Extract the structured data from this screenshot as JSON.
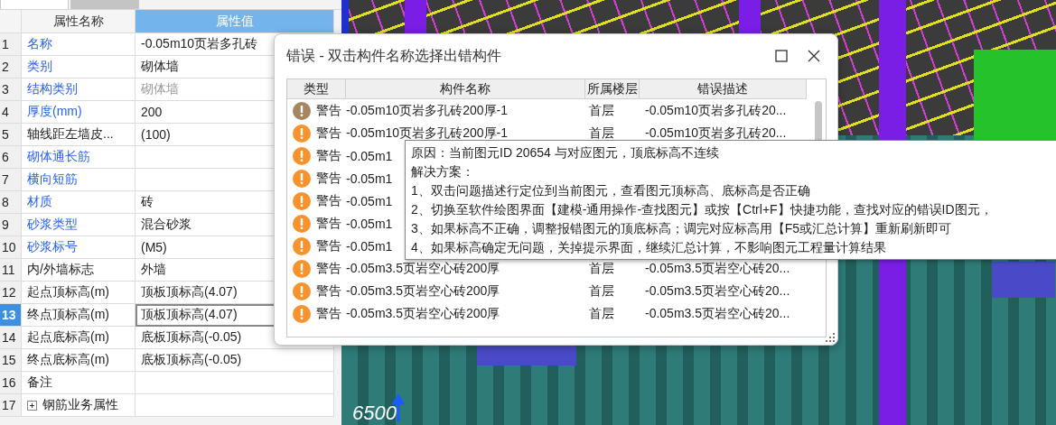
{
  "property_panel": {
    "tabs": [
      {
        "selected": true
      },
      {
        "selected": false
      }
    ],
    "columns": [
      {
        "label": "属性名称",
        "selected": false
      },
      {
        "label": "属性值",
        "selected": true
      }
    ],
    "rows": [
      {
        "number": "1",
        "name": "名称",
        "value": "-0.05m10页岩多孔砖",
        "highlighted": true,
        "disabled": false,
        "selected": false
      },
      {
        "number": "2",
        "name": "类别",
        "value": "砌体墙",
        "highlighted": true,
        "disabled": false,
        "selected": false
      },
      {
        "number": "3",
        "name": "结构类别",
        "value": "砌体墙",
        "highlighted": true,
        "disabled": true,
        "selected": false
      },
      {
        "number": "4",
        "name": "厚度(mm)",
        "value": "200",
        "highlighted": true,
        "disabled": false,
        "selected": false
      },
      {
        "number": "5",
        "name": "轴线距左墙皮...",
        "value": "(100)",
        "highlighted": false,
        "disabled": false,
        "selected": false
      },
      {
        "number": "6",
        "name": "砌体通长筋",
        "highlighted": true,
        "disabled": false,
        "selected": false
      },
      {
        "number": "7",
        "name": "横向短筋",
        "highlighted": true,
        "disabled": false,
        "selected": false
      },
      {
        "number": "8",
        "name": "材质",
        "value": "砖",
        "highlighted": true,
        "disabled": false,
        "selected": false
      },
      {
        "number": "9",
        "name": "砂浆类型",
        "value": "混合砂浆",
        "highlighted": true,
        "disabled": false,
        "selected": false
      },
      {
        "number": "10",
        "name": "砂浆标号",
        "value": "(M5)",
        "highlighted": true,
        "disabled": false,
        "selected": false
      },
      {
        "number": "11",
        "name": "内/外墙标志",
        "value": "外墙",
        "highlighted": false,
        "disabled": false,
        "selected": false
      },
      {
        "number": "12",
        "name": "起点顶标高(m)",
        "value": "顶板顶标高(4.07)",
        "highlighted": false,
        "disabled": false,
        "selected": false
      },
      {
        "number": "13",
        "name": "终点顶标高(m)",
        "value": "顶板顶标高(4.07)",
        "highlighted": false,
        "disabled": false,
        "selected": true
      },
      {
        "number": "14",
        "name": "起点底标高(m)",
        "value": "底板顶标高(-0.05)",
        "highlighted": false,
        "disabled": false,
        "selected": false
      },
      {
        "number": "15",
        "name": "终点底标高(m)",
        "value": "底板顶标高(-0.05)",
        "highlighted": false,
        "disabled": false,
        "selected": false
      },
      {
        "number": "16",
        "name": "备注",
        "highlighted": false,
        "disabled": false,
        "selected": false
      },
      {
        "number": "17",
        "name": "钢筋业务属性",
        "highlighted": false,
        "disabled": false,
        "selected": false,
        "expanded": false
      }
    ]
  },
  "view": {
    "label": "6500"
  },
  "dialog": {
    "title": "错误 - 双击构件名称选择出错构件",
    "columns": [
      "类型",
      "构件名称",
      "所属楼层",
      "错误描述"
    ],
    "rows": [
      {
        "type": "警告",
        "color": "#a6865e",
        "name": "-0.05m10页岩多孔砖200厚-1",
        "floor": "首层",
        "description": "-0.05m10页岩多孔砖20..."
      },
      {
        "type": "警告",
        "color": "#f7922c",
        "name": "-0.05m10页岩多孔砖200厚-1",
        "floor": "首层",
        "description": "-0.05m10页岩多孔砖20..."
      },
      {
        "type": "警告",
        "color": "#f7922c",
        "name": "-0.05m1"
      },
      {
        "type": "警告",
        "color": "#f7922c",
        "name": "-0.05m1"
      },
      {
        "type": "警告",
        "color": "#f7922c",
        "name": "-0.05m1"
      },
      {
        "type": "警告",
        "color": "#f7922c",
        "name": "-0.05m1"
      },
      {
        "type": "警告",
        "color": "#f7922c",
        "name": "-0.05m1"
      },
      {
        "type": "警告",
        "color": "#f7922c",
        "name": "-0.05m3.5页岩空心砖200厚",
        "floor": "首层",
        "description": "-0.05m3.5页岩空心砖20..."
      },
      {
        "type": "警告",
        "color": "#f7922c",
        "name": "-0.05m3.5页岩空心砖200厚",
        "floor": "首层",
        "description": "-0.05m3.5页岩空心砖20..."
      },
      {
        "type": "警告",
        "color": "#f7922c",
        "name": "-0.05m3.5页岩空心砖200厚",
        "floor": "首层",
        "description": "-0.05m3.5页岩空心砖20..."
      }
    ]
  },
  "tooltip": {
    "lines": [
      "原因：当前图元ID 20654 与对应图元，顶底标高不连续",
      "解决方案：",
      "1、双击问题描述行定位到当前图元，查看图元顶标高、底标高是否正确",
      "2、切换至软件绘图界面【建模-通用操作-查找图元】或按【Ctrl+F】快捷功能，查找对应的错误ID图元，",
      "3、如果标高不正确，调整报错图元的顶底标高；调完对应标高用【F5或汇总计算】重新刷新即可",
      "4、如果标高确定无问题，关掉提示界面，继续汇总计算，不影响图元工程量计算结果"
    ]
  }
}
